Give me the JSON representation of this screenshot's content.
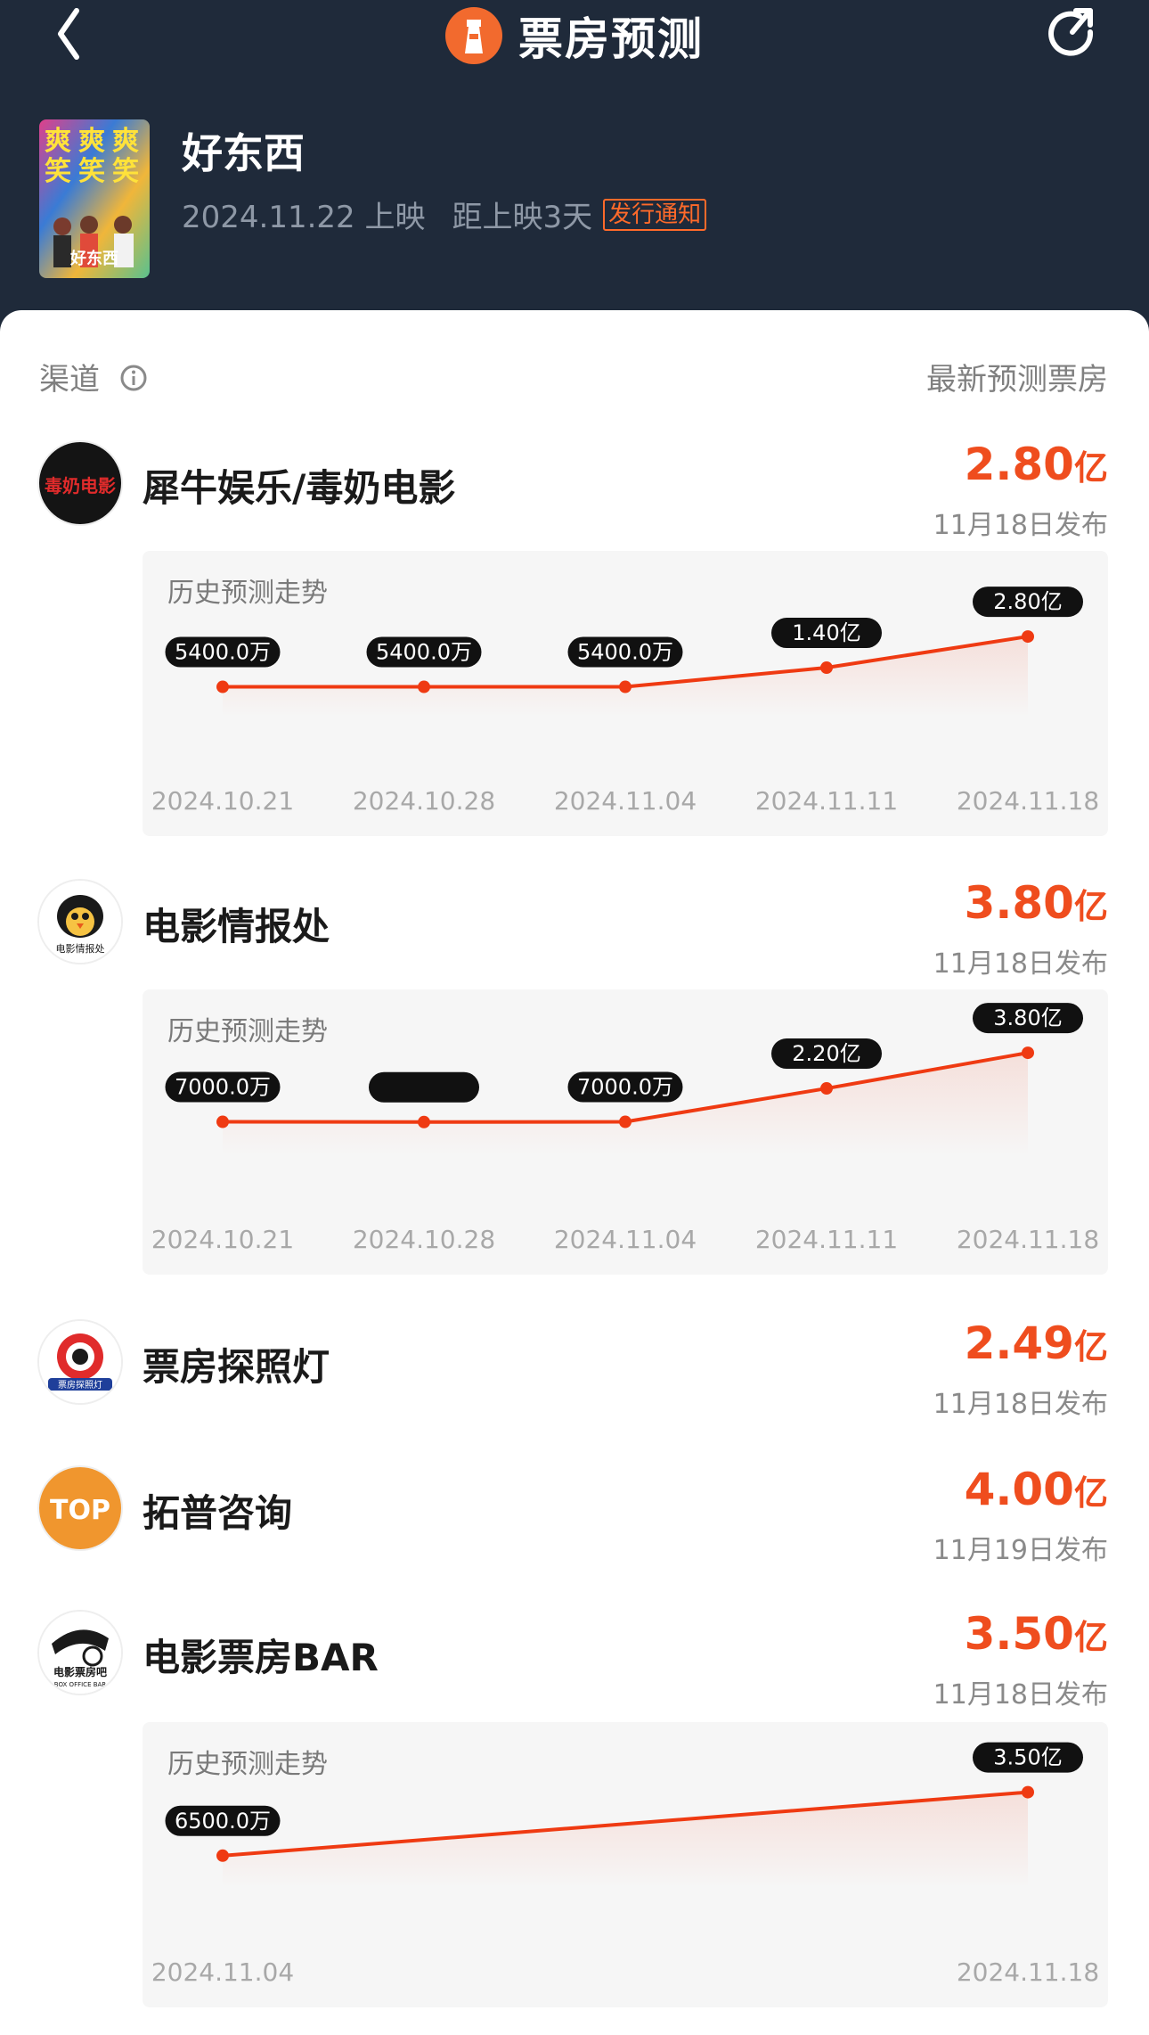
{
  "nav": {
    "title": "票房预测"
  },
  "movie": {
    "title": "好东西",
    "release": "2024.11.22 上映",
    "countdown": "距上映3天",
    "notice_badge": "发行通知",
    "poster_text": [
      "爽",
      "爽",
      "爽",
      "笑",
      "笑",
      "笑"
    ],
    "poster_logo": "好东西"
  },
  "columns": {
    "channel": "渠道",
    "latest": "最新预测票房"
  },
  "colors": {
    "accent": "#ef4d1e",
    "header_bg": "#1f2a3a",
    "line": "#ef3a12"
  },
  "channels": [
    {
      "name": "犀牛娱乐/毒奶电影",
      "value": "2.80",
      "unit": "亿",
      "date": "11月18日发布",
      "logo_icon": "poison-milk-logo-icon",
      "logo_text": "毒奶电影",
      "chart_title": "历史预测走势"
    },
    {
      "name": "电影情报处",
      "value": "3.80",
      "unit": "亿",
      "date": "11月18日发布",
      "logo_icon": "penguin-logo-icon",
      "logo_text": "电影情报处",
      "chart_title": "历史预测走势"
    },
    {
      "name": "票房探照灯",
      "value": "2.49",
      "unit": "亿",
      "date": "11月18日发布",
      "logo_icon": "searchlight-logo-icon",
      "logo_text": "票房探照灯"
    },
    {
      "name": "拓普咨询",
      "value": "4.00",
      "unit": "亿",
      "date": "11月19日发布",
      "logo_icon": "top-logo-icon",
      "logo_text": "TOP"
    },
    {
      "name": "电影票房BAR",
      "value": "3.50",
      "unit": "亿",
      "date": "11月18日发布",
      "logo_icon": "film-reel-logo-icon",
      "logo_text": "电影票房吧",
      "logo_subtext": "BOX OFFICE BAR",
      "chart_title": "历史预测走势"
    }
  ],
  "chart_data": [
    {
      "type": "line",
      "x": [
        "2024.10.21",
        "2024.10.28",
        "2024.11.04",
        "2024.11.11",
        "2024.11.18"
      ],
      "values": [
        5400,
        5400,
        5400,
        14000,
        28000
      ],
      "value_labels": [
        "5400.0万",
        "5400.0万",
        "5400.0万",
        "1.40亿",
        "2.80亿"
      ],
      "unit": "万"
    },
    {
      "type": "line",
      "x": [
        "2024.10.21",
        "2024.10.28",
        "2024.11.04",
        "2024.11.11",
        "2024.11.18"
      ],
      "values": [
        7000,
        6900,
        7000,
        22000,
        38000
      ],
      "value_labels": [
        "7000.0万",
        "",
        "7000.0万",
        "2.20亿",
        "3.80亿"
      ],
      "unit": "万"
    },
    {
      "type": "line",
      "x": [
        "2024.11.04",
        "2024.11.18"
      ],
      "values": [
        6500,
        35000
      ],
      "value_labels": [
        "6500.0万",
        "3.50亿"
      ],
      "unit": "万"
    }
  ]
}
